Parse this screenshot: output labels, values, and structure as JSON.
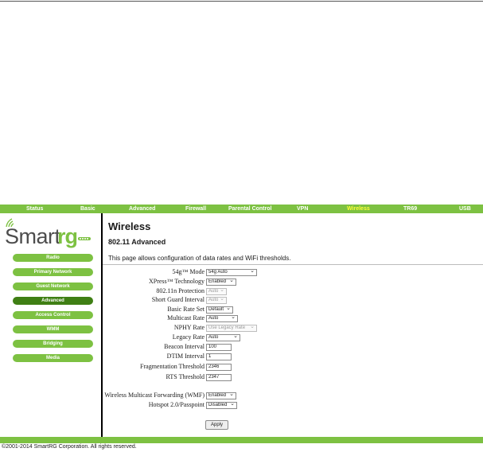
{
  "nav": {
    "items": [
      {
        "label": "Status"
      },
      {
        "label": "Basic"
      },
      {
        "label": "Advanced"
      },
      {
        "label": "Firewall"
      },
      {
        "label": "Parental Control"
      },
      {
        "label": "VPN"
      },
      {
        "label": "Wireless"
      },
      {
        "label": "TR69"
      },
      {
        "label": "USB"
      }
    ],
    "active": "Wireless",
    "color": "#7dc142"
  },
  "logo": {
    "part1": "Smart",
    "part2": "rg"
  },
  "sidebar": {
    "items": [
      {
        "label": "Radio"
      },
      {
        "label": "Primary Network"
      },
      {
        "label": "Guest Network"
      },
      {
        "label": "Advanced"
      },
      {
        "label": "Access Control"
      },
      {
        "label": "WMM"
      },
      {
        "label": "Bridging"
      },
      {
        "label": "Media"
      }
    ],
    "active": "Advanced"
  },
  "page": {
    "title": "Wireless",
    "section": "802.11 Advanced",
    "description": "This page allows configuration of data rates and WiFi thresholds."
  },
  "form": {
    "mode_54g": {
      "label": "54g™ Mode",
      "value": "54g Auto"
    },
    "xpress": {
      "label": "XPress™ Technology",
      "value": "Enabled"
    },
    "protection": {
      "label": "802.11n Protection",
      "value": "Auto"
    },
    "guard_interval": {
      "label": "Short Guard Interval",
      "value": "Auto"
    },
    "basic_rate": {
      "label": "Basic Rate Set",
      "value": "Default"
    },
    "multicast_rate": {
      "label": "Multicast Rate",
      "value": "Auto"
    },
    "nphy_rate": {
      "label": "NPHY Rate",
      "value": "Use Legacy Rate"
    },
    "legacy_rate": {
      "label": "Legacy Rate",
      "value": "Auto"
    },
    "beacon_interval": {
      "label": "Beacon Interval",
      "value": "100"
    },
    "dtim_interval": {
      "label": "DTIM Interval",
      "value": "1"
    },
    "frag_threshold": {
      "label": "Fragmentation Threshold",
      "value": "2346"
    },
    "rts_threshold": {
      "label": "RTS Threshold",
      "value": "2347"
    },
    "wmf": {
      "label": "Wireless Multicast Forwarding (WMF)",
      "value": "Enabled"
    },
    "hotspot": {
      "label": "Hotspot 2.0/Passpoint",
      "value": "Disabled"
    }
  },
  "apply_label": "Apply",
  "footer": {
    "text": "©2001-2014 SmartRG Corporation. All rights reserved."
  }
}
